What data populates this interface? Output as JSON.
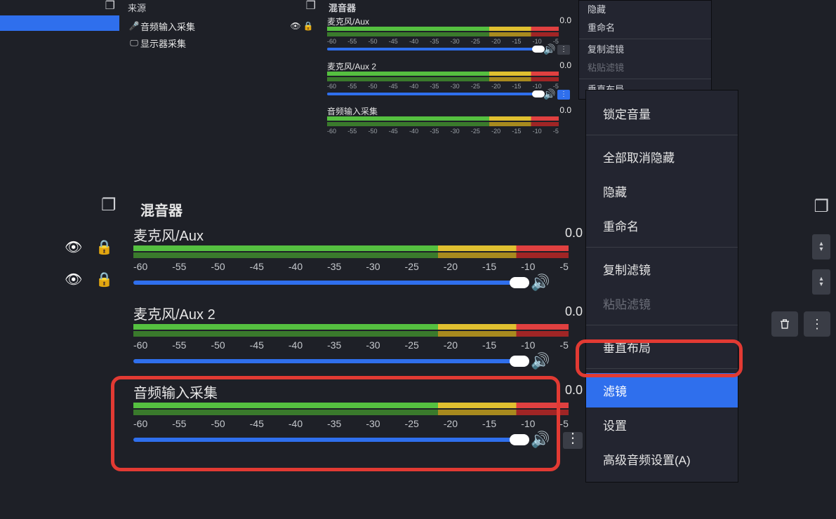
{
  "colors": {
    "accent": "#2f6fed",
    "danger": "#e23a33",
    "bg": "#1e2027",
    "panel": "#232530"
  },
  "ticks": [
    "-60",
    "-55",
    "-50",
    "-45",
    "-40",
    "-35",
    "-30",
    "-25",
    "-20",
    "-15",
    "-10",
    "-5"
  ],
  "top": {
    "sources_title": "来源",
    "mixer_title": "混音器",
    "sources": [
      {
        "icon": "mic",
        "label": "音频输入采集"
      },
      {
        "icon": "display",
        "label": "显示器采集"
      }
    ],
    "channels": [
      {
        "name": "麦克风/Aux",
        "db": "0.0",
        "options_active": false
      },
      {
        "name": "麦克风/Aux 2",
        "db": "0.0",
        "options_active": true
      },
      {
        "name": "音频输入采集",
        "db": "0.0",
        "options_active": false
      }
    ],
    "ctx": {
      "items": [
        {
          "label": "隐藏",
          "disabled": false
        },
        {
          "label": "重命名",
          "disabled": false
        },
        {
          "sep": true
        },
        {
          "label": "复制滤镜",
          "disabled": false
        },
        {
          "label": "粘贴滤镜",
          "disabled": true
        },
        {
          "sep": true
        },
        {
          "label": "垂直布局",
          "disabled": false
        }
      ]
    }
  },
  "zoom": {
    "mixer_title": "混音器",
    "channels": [
      {
        "name": "麦克风/Aux",
        "db": "0.0",
        "highlighted": false
      },
      {
        "name": "麦克风/Aux 2",
        "db": "0.0",
        "highlighted": false
      },
      {
        "name": "音频输入采集",
        "db": "0.0",
        "highlighted": true
      }
    ],
    "ctx": {
      "items": [
        {
          "label": "锁定音量"
        },
        {
          "sep": true
        },
        {
          "label": "全部取消隐藏"
        },
        {
          "label": "隐藏"
        },
        {
          "label": "重命名"
        },
        {
          "sep": true
        },
        {
          "label": "复制滤镜"
        },
        {
          "label": "粘贴滤镜",
          "disabled": true
        },
        {
          "sep": true
        },
        {
          "label": "垂直布局"
        },
        {
          "sep": true
        },
        {
          "label": "滤镜",
          "selected": true
        },
        {
          "label": "设置"
        },
        {
          "label": "高级音频设置(A)"
        }
      ]
    }
  }
}
